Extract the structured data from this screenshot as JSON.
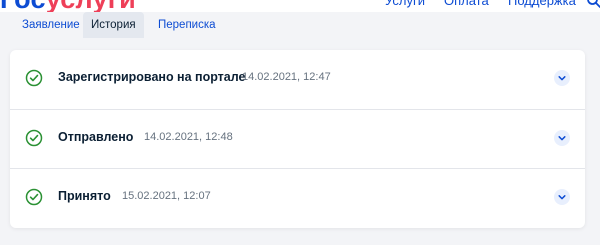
{
  "header": {
    "logo_part1": "Гос",
    "logo_part2": "услуги",
    "nav": [
      "Услуги",
      "Оплата",
      "Поддержка"
    ],
    "search_icon": "search-icon"
  },
  "tabs": [
    {
      "label": "Заявление",
      "active": false
    },
    {
      "label": "История",
      "active": true
    },
    {
      "label": "Переписка",
      "active": false
    }
  ],
  "history": [
    {
      "title": "Зарегистрировано на портале",
      "date": "14.02.2021, 12:47",
      "status_icon": "check-circle-icon"
    },
    {
      "title": "Отправлено",
      "date": "14.02.2021, 12:48",
      "status_icon": "check-circle-icon"
    },
    {
      "title": "Принято",
      "date": "15.02.2021, 12:07",
      "status_icon": "check-circle-icon"
    }
  ],
  "colors": {
    "brand_blue": "#0d4cd3",
    "brand_red": "#ee3f58",
    "success_green": "#2b9134",
    "background": "#f3f4f7",
    "card": "#ffffff"
  }
}
